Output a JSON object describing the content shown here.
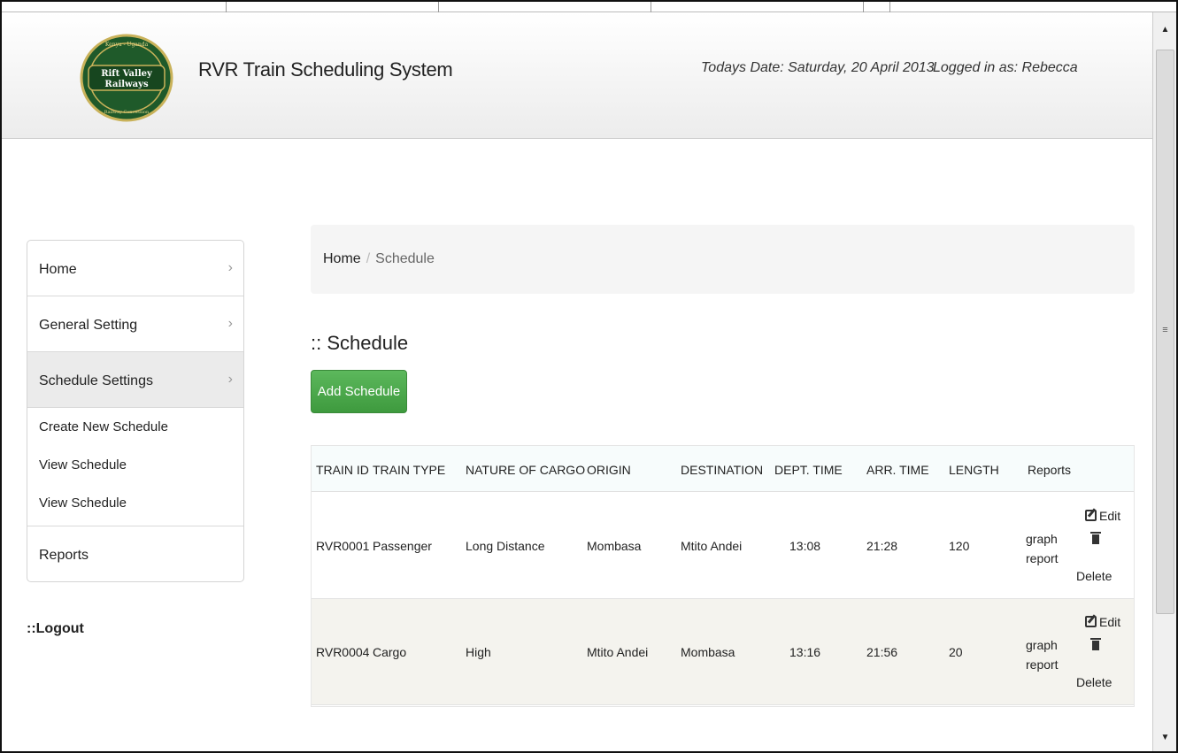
{
  "header": {
    "logo": {
      "line1": "Kenya - Uganda",
      "line2": "Rift Valley",
      "line3": "Railways",
      "line4": "Railway Concession"
    },
    "app_title": "RVR Train Scheduling System",
    "today_label": "Todays Date: Saturday, 20 April 2013",
    "logged_label": "Logged in as: Rebecca"
  },
  "sidebar": {
    "items": [
      {
        "label": "Home",
        "icon": "chevron-right-icon"
      },
      {
        "label": "General Setting",
        "icon": "chevron-right-icon"
      },
      {
        "label": "Schedule Settings",
        "icon": "chevron-right-icon"
      }
    ],
    "sub_items": [
      "Create New Schedule",
      "View Schedule",
      "View Schedule"
    ],
    "reports_label": "Reports"
  },
  "logout_label": "::Logout",
  "breadcrumb": {
    "home": "Home",
    "separator": "/",
    "current": "Schedule"
  },
  "page_title": ":: Schedule",
  "add_button_label": "Add Schedule",
  "table": {
    "columns": [
      "TRAIN ID",
      "TRAIN TYPE",
      "NATURE OF CARGO",
      "ORIGIN",
      "DESTINATION",
      "DEPT. TIME",
      "ARR. TIME",
      "LENGTH",
      "Reports"
    ],
    "rows": [
      {
        "train_id": "RVR0001",
        "train_type": "Passenger",
        "cargo": "Long Distance",
        "origin": "Mombasa",
        "destination": "Mtito Andei",
        "dept_time": "13:08",
        "arr_time": "21:28",
        "length": "120",
        "graph": "graph",
        "report": "report",
        "edit": "Edit",
        "delete": "Delete"
      },
      {
        "train_id": "RVR0004",
        "train_type": "Cargo",
        "cargo": "High",
        "origin": "Mtito Andei",
        "destination": "Mombasa",
        "dept_time": "13:16",
        "arr_time": "21:56",
        "length": "20",
        "graph": "graph",
        "report": "report",
        "edit": "Edit",
        "delete": "Delete"
      }
    ]
  },
  "colors": {
    "accent_green": "#4cae4c",
    "logo_green": "#1f5a2a",
    "logo_gold": "#c9b25a"
  },
  "scrollbar": {
    "up_icon": "scroll-up-arrow-icon",
    "down_icon": "scroll-down-arrow-icon"
  }
}
